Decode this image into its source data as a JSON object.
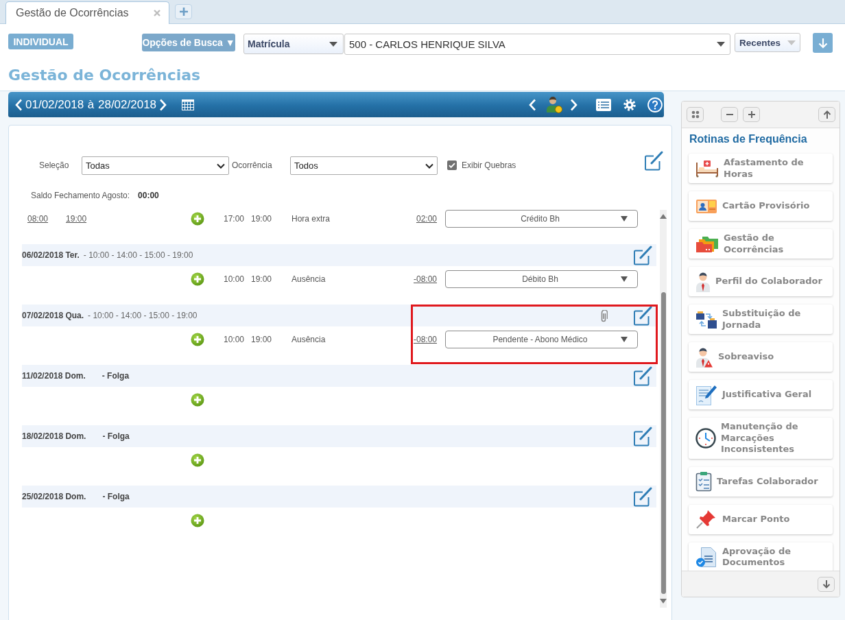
{
  "tabs": [
    {
      "label": "Gestão de Ocorrências",
      "selected": true
    }
  ],
  "search_bar": {
    "mode_button": "INDIVIDUAL",
    "options_button": "Opções de Busca ▼",
    "search_by": "Matrícula",
    "employee": "500 - CARLOS HENRIQUE SILVA",
    "recent": "Recentes"
  },
  "page_title": "Gestão de Ocorrências",
  "period_bar": {
    "period": "01/02/2018 à 28/02/2018"
  },
  "filters": {
    "selection": {
      "label": "Seleção",
      "value": "Todas"
    },
    "occurrence": {
      "label": "Ocorrência",
      "value": "Todos"
    },
    "show_breaks": {
      "label": "Exibir Quebras",
      "checked": true
    }
  },
  "balance": {
    "label": "Saldo Fechamento Agosto:",
    "value": "00:00"
  },
  "days": [
    {
      "kind": "continued",
      "entry": {
        "punches": [
          "08:00",
          "19:00"
        ],
        "start": "17:00",
        "end": "19:00",
        "type": "Hora extra",
        "hours": "02:00",
        "treatment": "Crédito Bh"
      }
    },
    {
      "kind": "work",
      "date": "06/02/2018 Ter.",
      "schedule": "- 10:00 - 14:00 - 15:00 - 19:00",
      "attachment": false,
      "highlighted": false,
      "entry": {
        "start": "10:00",
        "end": "19:00",
        "type": "Ausência",
        "hours": "-08:00",
        "treatment": "Débito Bh"
      }
    },
    {
      "kind": "work",
      "date": "07/02/2018 Qua.",
      "schedule": "- 10:00 - 14:00 - 15:00 - 19:00",
      "attachment": true,
      "highlighted": true,
      "entry": {
        "start": "10:00",
        "end": "19:00",
        "type": "Ausência",
        "hours": "-08:00",
        "treatment": "Pendente - Abono Médico"
      }
    },
    {
      "kind": "off",
      "date": "11/02/2018 Dom.",
      "schedule": "- Folga",
      "attachment": false,
      "highlighted": false
    },
    {
      "kind": "off",
      "date": "18/02/2018 Dom.",
      "schedule": "- Folga",
      "attachment": false,
      "highlighted": false
    },
    {
      "kind": "off",
      "date": "25/02/2018 Dom.",
      "schedule": "- Folga",
      "attachment": false,
      "highlighted": false
    }
  ],
  "sidebar": {
    "title": "Rotinas de Frequência",
    "items": [
      "Afastamento de Horas",
      "Cartão Provisório",
      "Gestão de Ocorrências",
      "Perfil do Colaborador",
      "Substituição de Jornada",
      "Sobreaviso",
      "Justificativa Geral",
      "Manutenção de Marcações Inconsistentes",
      "Tarefas Colaborador",
      "Marcar Ponto",
      "Aprovação de Documentos"
    ]
  }
}
